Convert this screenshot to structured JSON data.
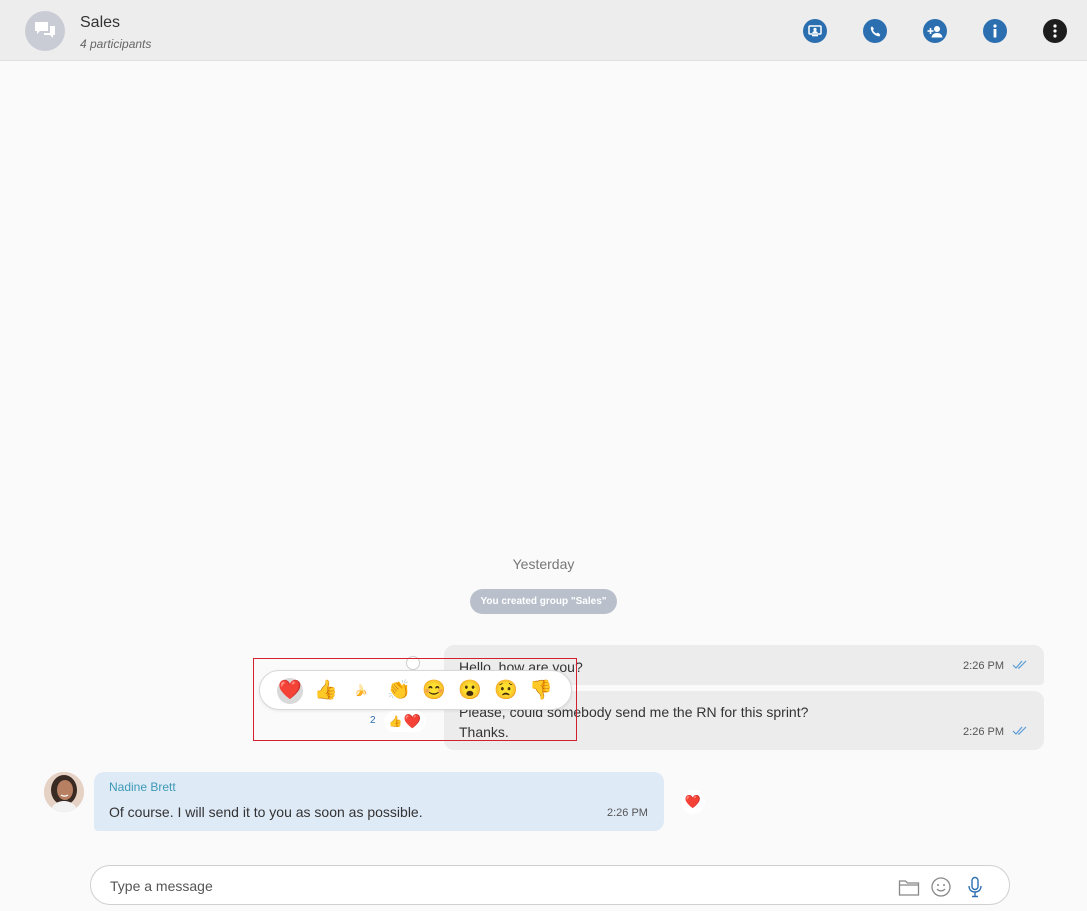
{
  "header": {
    "title": "Sales",
    "subtitle": "4 participants",
    "actions": [
      "screen-share-icon",
      "phone-icon",
      "add-participant-icon",
      "info-icon",
      "more-icon"
    ]
  },
  "conversation": {
    "date_separator": "Yesterday",
    "system_message": "You created group \"Sales\"",
    "outgoing": [
      {
        "text": "Hello, how are you?",
        "time": "2:26 PM",
        "status": "read"
      },
      {
        "text": "Please, could somebody send me the RN for this sprint?\nThanks.",
        "time": "2:26 PM",
        "status": "read"
      }
    ],
    "incoming": {
      "sender": "Nadine Brett",
      "text": "Of course. I will send it to you as soon as possible.",
      "time": "2:26 PM",
      "reaction": "❤️"
    }
  },
  "reaction_picker": {
    "options": [
      "❤️",
      "👍",
      "🍌",
      "👏",
      "😊",
      "😮",
      "😟",
      "👎"
    ],
    "selected": "❤️"
  },
  "reaction_summary": {
    "count": "2",
    "emojis": [
      "👍",
      "❤️"
    ]
  },
  "composer": {
    "placeholder": "Type a message",
    "icons": [
      "folder-icon",
      "emoji-icon",
      "microphone-icon"
    ]
  },
  "colors": {
    "accent": "#2b6fb0",
    "incoming_bubble": "#dfeaf7",
    "outgoing_bubble": "#ececec",
    "sender_name": "#3c99b5",
    "highlight_box": "#d2202f"
  }
}
